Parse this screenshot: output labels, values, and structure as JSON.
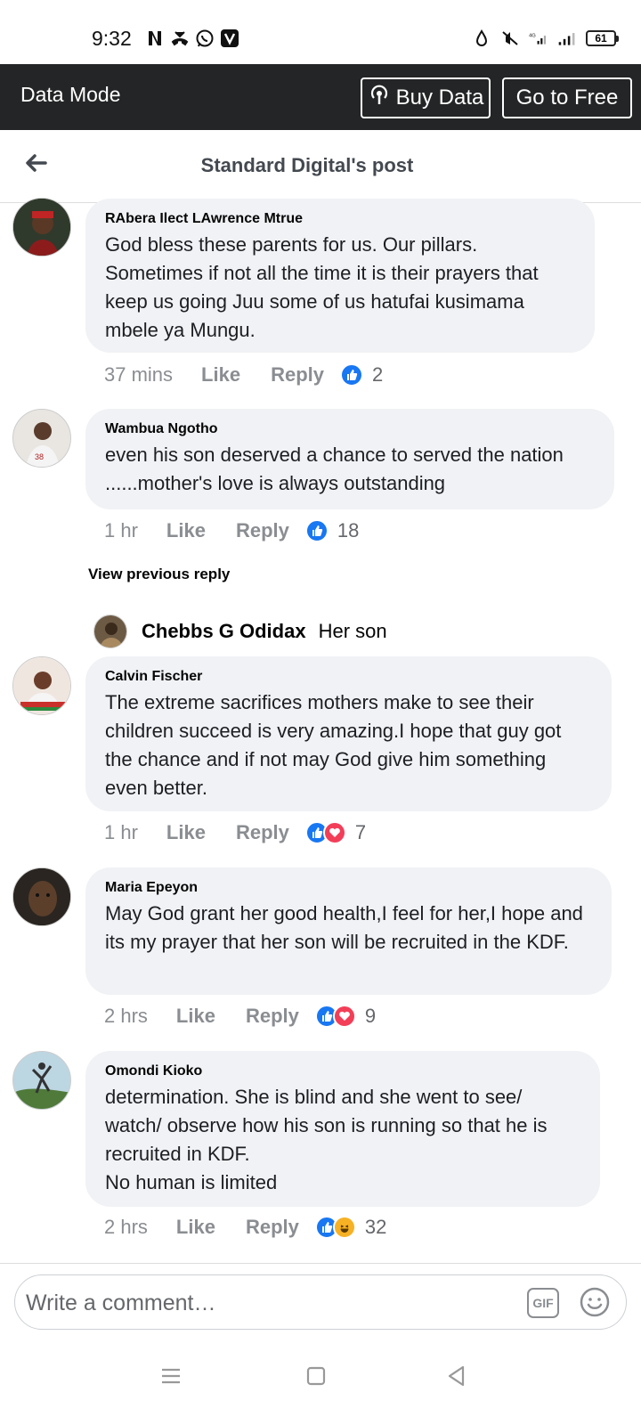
{
  "status_bar": {
    "time": "9:32",
    "battery": "61",
    "network": "4G"
  },
  "data_mode": {
    "title": "Data Mode",
    "buy_label": "Buy Data",
    "free_label": "Go to Free"
  },
  "header": {
    "title": "Standard Digital's post"
  },
  "comments": [
    {
      "author": "RAbera Ilect LAwrence Mtrue",
      "text": "God bless these parents for us. Our pillars. Sometimes if not all the time it is their prayers that keep us going Juu some of us hatufai kusimama mbele ya  Mungu.",
      "time": "37 mins",
      "like": "Like",
      "reply": "Reply",
      "reactions": [
        "like"
      ],
      "count": "2"
    },
    {
      "author": "Wambua Ngotho",
      "text": "even his son deserved a chance to served the nation ......mother's love is always outstanding",
      "time": "1 hr",
      "like": "Like",
      "reply": "Reply",
      "reactions": [
        "like"
      ],
      "count": "18"
    },
    {
      "author": "Calvin Fischer",
      "text": "The extreme sacrifices mothers make to see their children succeed is very amazing.I hope that guy got the chance and if not may God give him something even better.",
      "time": "1 hr",
      "like": "Like",
      "reply": "Reply",
      "reactions": [
        "like",
        "love"
      ],
      "count": "7"
    },
    {
      "author": "Maria Epeyon",
      "text": "May God grant her good health,I feel for her,I hope and its my prayer that her son will be recruited in the KDF.",
      "time": "2 hrs",
      "like": "Like",
      "reply": "Reply",
      "reactions": [
        "like",
        "love"
      ],
      "count": "9"
    },
    {
      "author": "Omondi Kioko",
      "text": "determination. She is blind and she went to see/ watch/ observe how his son is running so that he is recruited in KDF.\nNo human is limited",
      "time": "2 hrs",
      "like": "Like",
      "reply": "Reply",
      "reactions": [
        "like",
        "haha"
      ],
      "count": "32"
    }
  ],
  "view_previous": "View previous reply",
  "nested_reply": {
    "author": "Chebbs G Odidax",
    "text": "Her son"
  },
  "composer": {
    "placeholder": "Write a comment…",
    "gif_label": "GIF"
  }
}
